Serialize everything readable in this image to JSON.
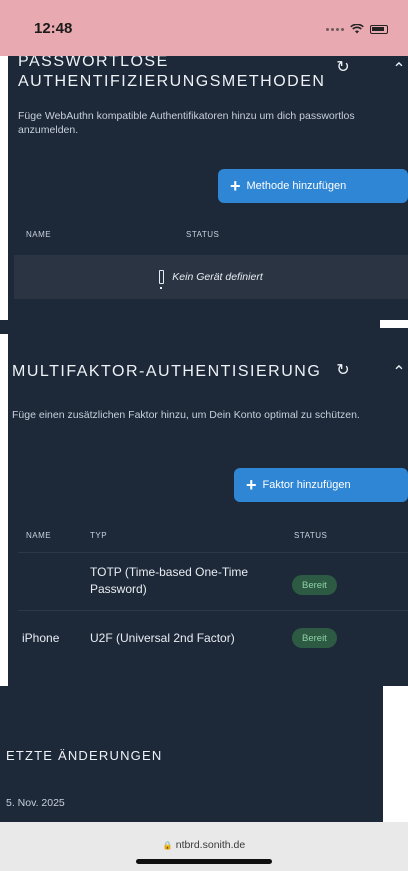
{
  "status_bar": {
    "time": "12:48"
  },
  "passwordless": {
    "title": "PASSWORTLOSE AUTHENTIFIZIERUNGSMETHODEN",
    "description": "Füge WebAuthn kompatible Authentifikatoren hinzu um dich passwortlos anzumelden.",
    "add_button": "Methode hinzufügen",
    "columns": [
      "NAME",
      "STATUS"
    ],
    "empty_message": "Kein Gerät definiert"
  },
  "mfa": {
    "title": "MULTIFAKTOR-AUTHENTISIERUNG",
    "description": "Füge einen zusätzlichen Faktor hinzu, um Dein Konto optimal zu schützen.",
    "add_button": "Faktor hinzufügen",
    "columns": [
      "NAME",
      "TYP",
      "STATUS"
    ],
    "rows": [
      {
        "name": "",
        "type": "TOTP (Time-based One-Time Password)",
        "status": "Bereit"
      },
      {
        "name": "iPhone",
        "type": "U2F (Universal 2nd Factor)",
        "status": "Bereit"
      }
    ]
  },
  "recent_changes": {
    "title": "ETZTE ÄNDERUNGEN",
    "date": "5. Nov. 2025"
  },
  "browser": {
    "url": "ntbrd.sonith.de"
  },
  "colors": {
    "status_bar": "#e8a9b0",
    "panel_bg": "#1d2838",
    "accent": "#2e86d5",
    "badge_bg": "#2c5a43",
    "badge_text": "#8fd1a6"
  }
}
